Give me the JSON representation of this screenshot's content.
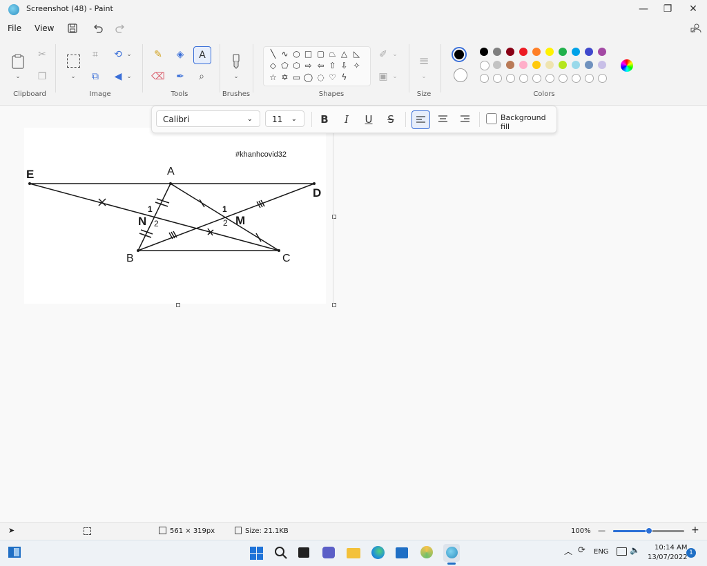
{
  "window": {
    "title": "Screenshot (48) - Paint",
    "minimize": "—",
    "restore": "❐",
    "close": "✕"
  },
  "menu": {
    "file": "File",
    "view": "View"
  },
  "ribbon": {
    "groups": {
      "clipboard": "Clipboard",
      "image": "Image",
      "tools": "Tools",
      "brushes": "Brushes",
      "shapes": "Shapes",
      "size": "Size",
      "colors": "Colors"
    }
  },
  "text_toolbar": {
    "font": "Calibri",
    "size": "11",
    "bold": "B",
    "italic": "I",
    "underline": "U",
    "strike": "S",
    "background_fill": "Background fill"
  },
  "colors": {
    "primary": "#000000",
    "secondary": "#ffffff",
    "row1": [
      "#000000",
      "#7f7f7f",
      "#880015",
      "#ed1c24",
      "#ff7f27",
      "#fff200",
      "#22b14c",
      "#00a2e8",
      "#3f48cc",
      "#a349a4"
    ],
    "row2": [
      "#ffffff",
      "#c3c3c3",
      "#b97a57",
      "#ffaec9",
      "#ffc90e",
      "#efe4b0",
      "#b5e61d",
      "#99d9ea",
      "#7092be",
      "#c8bfe7"
    ]
  },
  "figure": {
    "hashtag": "#khanhcovid32",
    "labels": {
      "E": "E",
      "A": "A",
      "D": "D",
      "N": "N",
      "M": "M",
      "B": "B",
      "C": "C",
      "n1": "1",
      "n2": "2",
      "m1": "1",
      "m2": "2"
    }
  },
  "status": {
    "dimensions": "561 × 319px",
    "size": "Size: 21.1KB",
    "zoom": "100%",
    "zoom_minus": "—",
    "zoom_plus": "+",
    "zoom_level": 0.5
  },
  "taskbar": {
    "language": "ENG",
    "time": "10:14 AM",
    "date": "13/07/2022",
    "notifications": "1"
  }
}
